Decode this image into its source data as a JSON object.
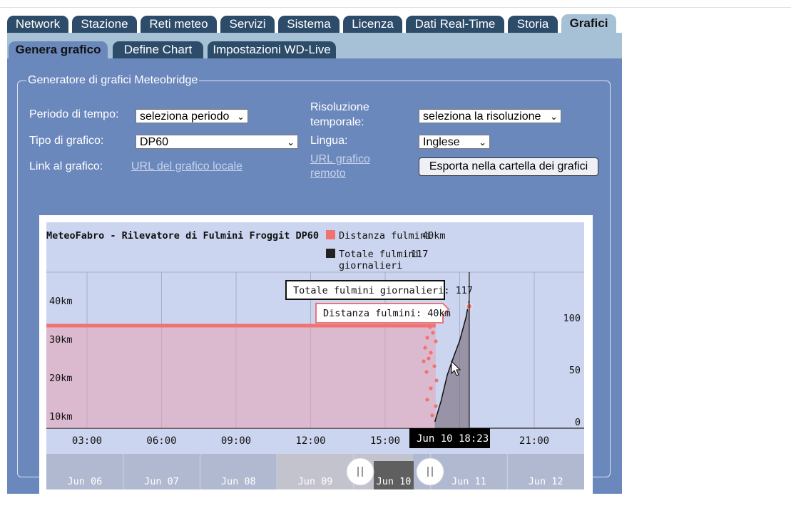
{
  "tabs": [
    "Network",
    "Stazione",
    "Reti meteo",
    "Servizi",
    "Sistema",
    "Licenza",
    "Dati Real-Time",
    "Storia",
    "Grafici"
  ],
  "subtabs": [
    "Genera grafico",
    "Define Chart",
    "Impostazioni WD-Live"
  ],
  "generator": {
    "legend": "Generatore di grafici Meteobridge",
    "periodo_label": "Periodo di tempo:",
    "periodo_value": "seleziona periodo",
    "risoluzione_label_1": "Risoluzione",
    "risoluzione_label_2": "temporale:",
    "risoluzione_value": "seleziona la risoluzione",
    "tipo_label": "Tipo di grafico:",
    "tipo_value": "DP60",
    "lingua_label": "Lingua:",
    "lingua_value": "Inglese",
    "link_label": "Link al grafico:",
    "url_locale": "URL del grafico locale",
    "url_remoto_1": "URL grafico",
    "url_remoto_2": "remoto",
    "export_button": "Esporta nella cartella dei grafici"
  },
  "chart_data": {
    "type": "area",
    "title": "MeteoFabro - Rilevatore di Fulmini Froggit DP60",
    "legend": [
      {
        "label": "Distanza fulmini",
        "value": "40km",
        "color": "#f07373"
      },
      {
        "label_1": "Totale fulmini",
        "label_2": "giornalieri",
        "value": "117",
        "color": "#222222"
      }
    ],
    "x_ticks": [
      "03:00",
      "06:00",
      "09:00",
      "12:00",
      "15:00",
      "21:00"
    ],
    "y_left_ticks": [
      "10km",
      "20km",
      "30km",
      "40km"
    ],
    "y_right_ticks": [
      "0",
      "50",
      "100"
    ],
    "series": [
      {
        "name": "Distanza fulmini",
        "unit": "km",
        "x": [
          "00:00",
          "17:02"
        ],
        "y": [
          35,
          35
        ]
      },
      {
        "name": "Totale fulmini giornalieri",
        "x": [
          "17:00",
          "17:15",
          "17:30",
          "17:45",
          "18:00",
          "18:15",
          "18:23"
        ],
        "y": [
          0,
          20,
          45,
          62,
          78,
          100,
          117
        ]
      }
    ],
    "tooltip_total": "Totale fulmini giornalieri: 117",
    "tooltip_distance": "Distanza fulmini: 40km",
    "crosshair_label": "Jun 10 18:23",
    "navigator_days": [
      "Jun 06",
      "Jun 07",
      "Jun 08",
      "Jun 09",
      "Jun 10",
      "Jun 11",
      "Jun 12"
    ]
  }
}
